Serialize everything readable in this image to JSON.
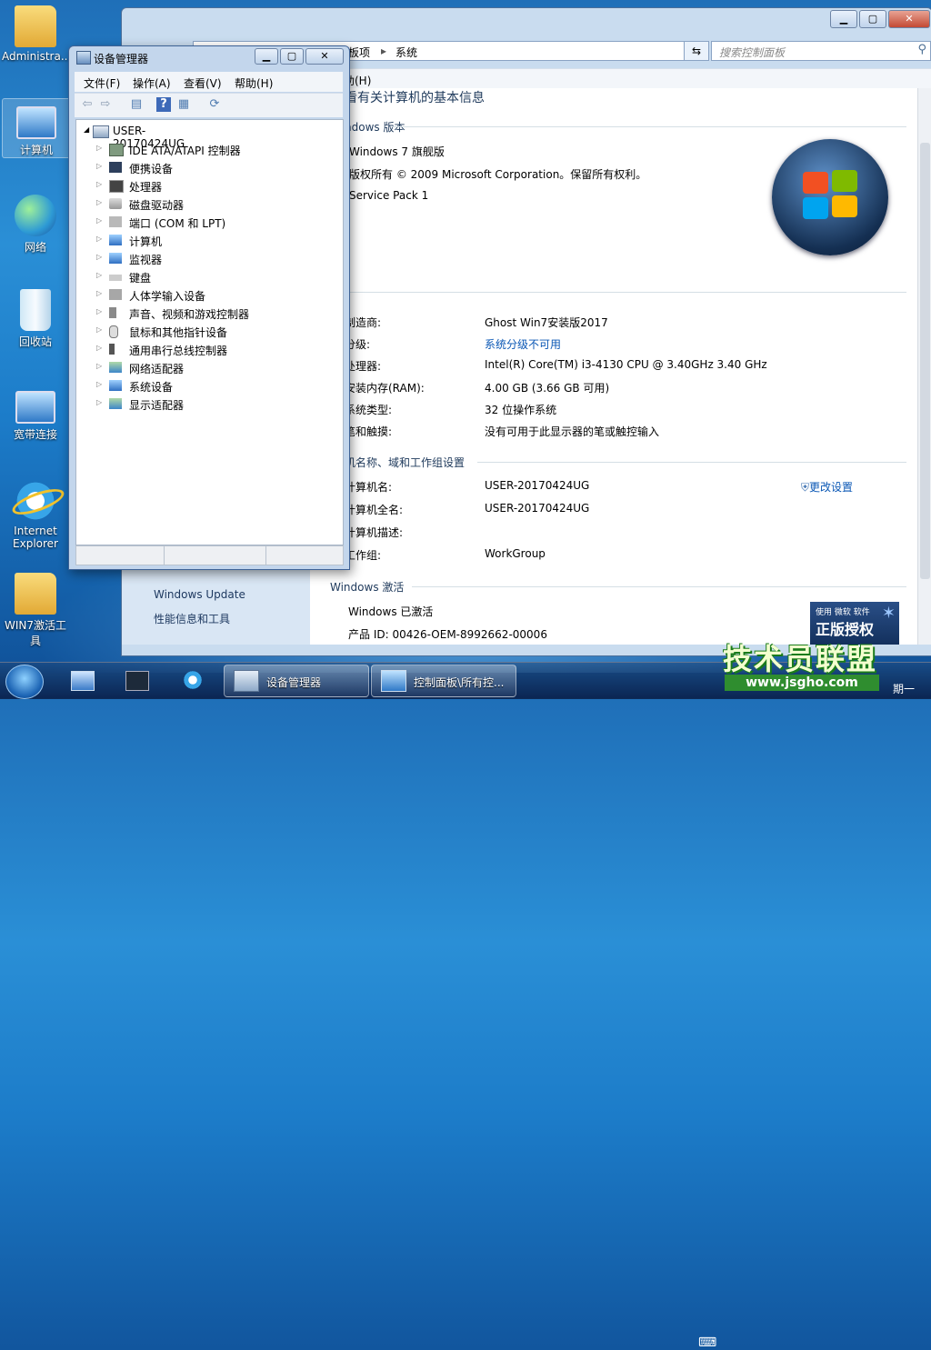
{
  "desktop": {
    "icons": [
      {
        "label": "Administra..."
      },
      {
        "label": "计算机"
      },
      {
        "label": "网络"
      },
      {
        "label": "回收站"
      },
      {
        "label": "宽带连接"
      },
      {
        "label": "Internet Explorer"
      },
      {
        "label": "WIN7激活工具"
      }
    ]
  },
  "control_panel": {
    "breadcrumb_a": "板项",
    "breadcrumb_b": "系统",
    "search_placeholder": "搜索控制面板",
    "menu_help": "助(H)",
    "left_links": [
      "Windows Update",
      "性能信息和工具"
    ],
    "header_partial": "看有关计算机的基本信息",
    "edition_heading": "ndows 版本",
    "edition": "Windows 7 旗舰版",
    "copyright": "版权所有 © 2009 Microsoft Corporation。保留所有权利。",
    "service_pack": "Service Pack 1",
    "system_rows": [
      {
        "label": "制造商:",
        "value": "Ghost Win7安装版2017"
      },
      {
        "label": "分级:",
        "value": "系统分级不可用"
      },
      {
        "label": "处理器:",
        "value": "Intel(R) Core(TM) i3-4130 CPU @ 3.40GHz   3.40 GHz"
      },
      {
        "label": "安装内存(RAM):",
        "value": "4.00 GB (3.66 GB 可用)"
      },
      {
        "label": "系统类型:",
        "value": "32 位操作系统"
      },
      {
        "label": "笔和触摸:",
        "value": "没有可用于此显示器的笔或触控输入"
      }
    ],
    "name_heading": "机名称、域和工作组设置",
    "name_rows": [
      {
        "label": "计算机名:",
        "value": "USER-20170424UG"
      },
      {
        "label": "计算机全名:",
        "value": "USER-20170424UG"
      },
      {
        "label": "计算机描述:",
        "value": ""
      },
      {
        "label": "工作组:",
        "value": "WorkGroup"
      }
    ],
    "change_settings": "更改设置",
    "activation_heading": "Windows 激活",
    "activated": "Windows 已激活",
    "product_id": "产品 ID: 00426-OEM-8992662-00006",
    "badge_top": "使用 微软 软件",
    "badge_main": "正版授权"
  },
  "device_manager": {
    "title": "设备管理器",
    "menu": [
      "文件(F)",
      "操作(A)",
      "查看(V)",
      "帮助(H)"
    ],
    "root": "USER-20170424UG",
    "nodes": [
      "IDE ATA/ATAPI 控制器",
      "便携设备",
      "处理器",
      "磁盘驱动器",
      "端口 (COM 和 LPT)",
      "计算机",
      "监视器",
      "键盘",
      "人体学输入设备",
      "声音、视频和游戏控制器",
      "鼠标和其他指针设备",
      "通用串行总线控制器",
      "网络适配器",
      "系统设备",
      "显示适配器"
    ]
  },
  "taskbar": {
    "tasks": [
      "设备管理器",
      "控制面板\\所有控..."
    ],
    "clock_partial": "期一"
  },
  "watermark": {
    "main": "技术员联盟",
    "url": "www.jsgho.com"
  },
  "colors": {
    "link": "#0a57b5",
    "heading": "#1e395b"
  }
}
